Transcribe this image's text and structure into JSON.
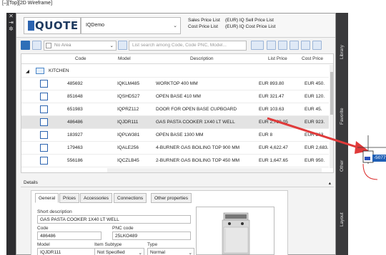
{
  "viewport": {
    "label": "[–][Top][2D Wireframe]"
  },
  "app": {
    "logo": "QUOTE",
    "catalog": "IQDemo",
    "price_lists": [
      {
        "key": "Sales Price List",
        "value": "(EUR) IQ Sell Price List"
      },
      {
        "key": "Cost Price List",
        "value": "(EUR) IQ Cost Price List"
      }
    ]
  },
  "toolbar": {
    "area_placeholder": "No Area",
    "search_placeholder": "List search among Code, Code PNC, Model..."
  },
  "grid": {
    "columns": [
      "Code",
      "Model",
      "Description",
      "List Price",
      "Cost Price"
    ],
    "group": "KITCHEN",
    "rows": [
      {
        "code": "485692",
        "model": "IQKLM485",
        "desc": "WORKTOP 400 MM",
        "list": "EUR 893.80",
        "cost": "EUR 450."
      },
      {
        "code": "851648",
        "model": "IQSHD527",
        "desc": "OPEN BASE 410 MM",
        "list": "EUR 321.47",
        "cost": "EUR 120."
      },
      {
        "code": "651983",
        "model": "IQPRZ112",
        "desc": "DOOR FOR OPEN BASE CUPBOARD",
        "list": "EUR 103.63",
        "cost": "EUR 45."
      },
      {
        "code": "486486",
        "model": "IQJDR111",
        "desc": "GAS PASTA COOKER 1X40 LT WELL",
        "list": "EUR 2,789.05",
        "cost": "EUR 923."
      },
      {
        "code": "183927",
        "model": "IQPLW381",
        "desc": "OPEN BASE 1300 MM",
        "list": "EUR 8",
        "cost": "EUR 263."
      },
      {
        "code": "179463",
        "model": "IQALE256",
        "desc": "4-BURNER GAS BOILING TOP 900 MM",
        "list": "EUR 4,622.47",
        "cost": "EUR 2,683."
      },
      {
        "code": "556186",
        "model": "IQCZLB45",
        "desc": "2-BURNER GAS BOILING TOP 450 MM",
        "list": "EUR 1,647.65",
        "cost": "EUR 950."
      }
    ]
  },
  "details": {
    "title": "Details",
    "tabs": [
      "General",
      "Prices",
      "Accessories",
      "Connections",
      "Other properties"
    ],
    "short_desc_label": "Short description",
    "short_desc": "GAS PASTA COOKER 1X40 LT WELL",
    "code_label": "Code",
    "code": "486486",
    "pnc_label": "PNC code",
    "pnc": "25LKO489",
    "model_label": "Model",
    "model": "IQJDR111",
    "subtype_label": "Item Subtype",
    "subtype": "Not Specified",
    "type_label": "Type",
    "type": "Normal"
  },
  "side_tabs": [
    "Library",
    "Favorite",
    "Other",
    "Layout"
  ],
  "cad": {
    "coord": "-5077"
  }
}
